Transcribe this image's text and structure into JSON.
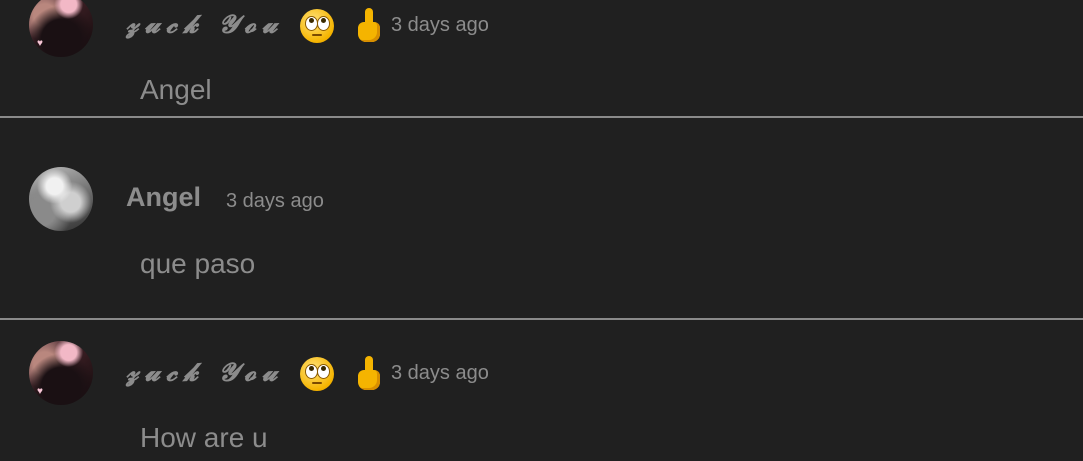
{
  "comments": [
    {
      "username": "𝔃𝓾𝓬𝓴 𝓨𝓸𝓾",
      "avatar_icon": "avatar-pink",
      "emojis": [
        "eyeroll-icon",
        "middle-finger-icon"
      ],
      "time": "3 days ago",
      "text": "Angel"
    },
    {
      "username": "Angel",
      "avatar_icon": "avatar-gray",
      "emojis": [],
      "time": "3 days ago",
      "text": "que paso"
    },
    {
      "username": "𝔃𝓾𝓬𝓴 𝓨𝓸𝓾",
      "avatar_icon": "avatar-pink",
      "emojis": [
        "eyeroll-icon",
        "middle-finger-icon"
      ],
      "time": "3 days ago",
      "text": "How are u"
    }
  ],
  "colors": {
    "background": "#202020",
    "text": "#8c8c8c",
    "divider": "#8a8a8a"
  }
}
